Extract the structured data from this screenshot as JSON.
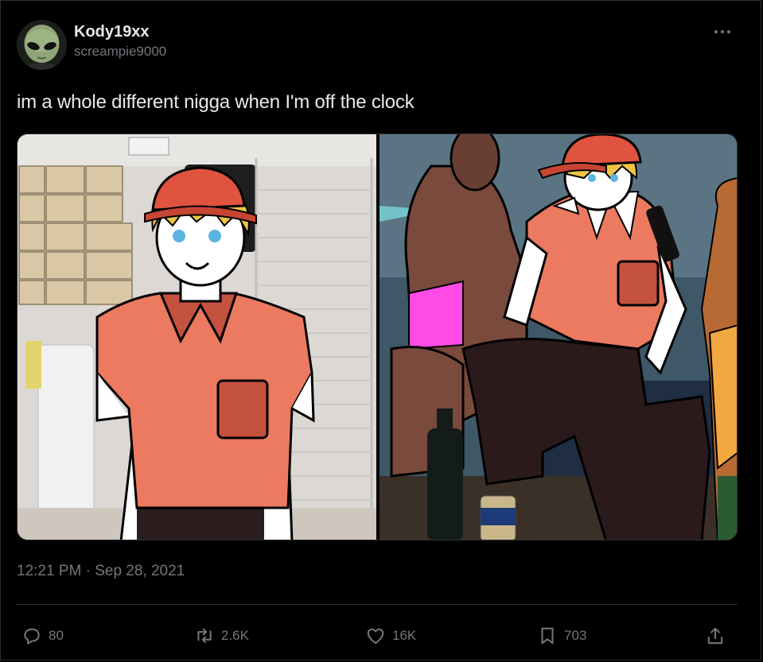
{
  "tweet": {
    "author_name": "Kody19xx",
    "author_handle": "screampie9000",
    "text": "im a whole different nigga when I'm off the clock",
    "timestamp": "12:21 PM · Sep 28, 2021"
  },
  "actions": {
    "replies": "80",
    "retweets": "2.6K",
    "likes": "16K",
    "bookmarks": "703"
  },
  "icons": {
    "more": "more-dots-icon",
    "reply": "reply-icon",
    "retweet": "retweet-icon",
    "like": "heart-icon",
    "bookmark": "bookmark-icon",
    "share": "share-icon"
  },
  "colors": {
    "background": "#000000",
    "text_primary": "#e7e9ea",
    "text_secondary": "#71767b",
    "border": "#2f3336"
  }
}
